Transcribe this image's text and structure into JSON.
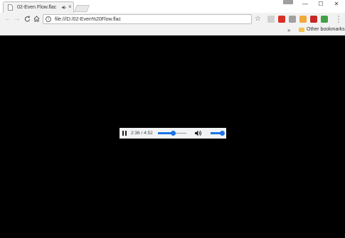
{
  "window": {
    "tab": {
      "title": "02-Even Flow.flac",
      "favicon": "document-icon",
      "speaker": "speaker-icon",
      "close": "close-icon"
    },
    "controls": {
      "minimize": "—",
      "maximize": "☐",
      "close": "✕"
    }
  },
  "toolbar": {
    "back": "←",
    "forward": "→",
    "reload": "C",
    "home": "⌂",
    "url": "file:///D:/02-Even%20Flow.flac",
    "star": "☆",
    "extensions": [
      {
        "name": "pocket-icon",
        "color": "#d0d0d0"
      },
      {
        "name": "badge-extension-icon",
        "color": "#d93025"
      },
      {
        "name": "cast-icon",
        "color": "#a0a0a0"
      },
      {
        "name": "chrome-extension-icon",
        "color": "#f0a93b"
      },
      {
        "name": "adblock-icon",
        "color": "#c62828"
      },
      {
        "name": "green-extension-icon",
        "color": "#43a047"
      }
    ],
    "menu": "⋮"
  },
  "bookmarks": {
    "overflow": "»",
    "folder_label": "Other bookmarks"
  },
  "player": {
    "current_time": "2:36",
    "duration": "4:52",
    "time_display": "2:36 / 4:52",
    "progress_fraction": 0.534,
    "volume_fraction": 1.0,
    "accent": "#1a73e8"
  }
}
